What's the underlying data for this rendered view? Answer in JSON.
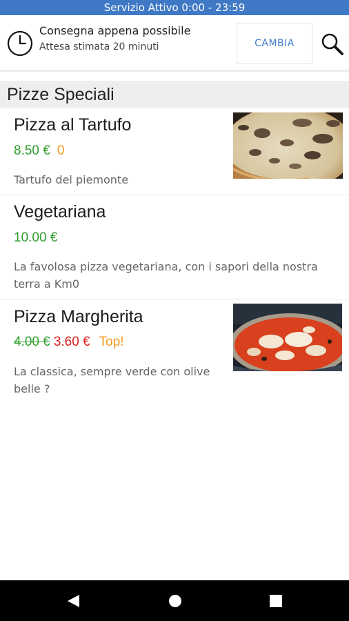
{
  "status_bar": {
    "text": "Servizio Attivo  0:00 - 23:59"
  },
  "delivery": {
    "icon": "clock-icon",
    "title": "Consegna appena possibile",
    "subtitle": "Attesa stimata 20 minuti",
    "change_label": "CAMBIA",
    "search_icon": "search-icon"
  },
  "section": {
    "title": "Pizze Speciali"
  },
  "items": [
    {
      "name": "Pizza al Tartufo",
      "price": "8.50 €",
      "extra": "0",
      "description": "Tartufo del piemonte",
      "has_image": true
    },
    {
      "name": "Vegetariana",
      "price": "10.00 €",
      "description": "La favolosa pizza vegetariana, con i sapori della nostra terra a Km0",
      "has_image": false
    },
    {
      "name": "Pizza Margherita",
      "old_price": "4.00 €",
      "price": "3.60 €",
      "badge": "Top!",
      "description": "La classica, sempre verde con olive belle ?",
      "has_image": true
    }
  ],
  "colors": {
    "status_bar": "#3f79c5",
    "accent": "#3f79c5",
    "price_green": "#2e9d2a",
    "price_red": "#e01b1b",
    "badge_orange": "#f49b1c"
  },
  "navigation": [
    "back-icon",
    "home-icon",
    "recents-icon"
  ]
}
